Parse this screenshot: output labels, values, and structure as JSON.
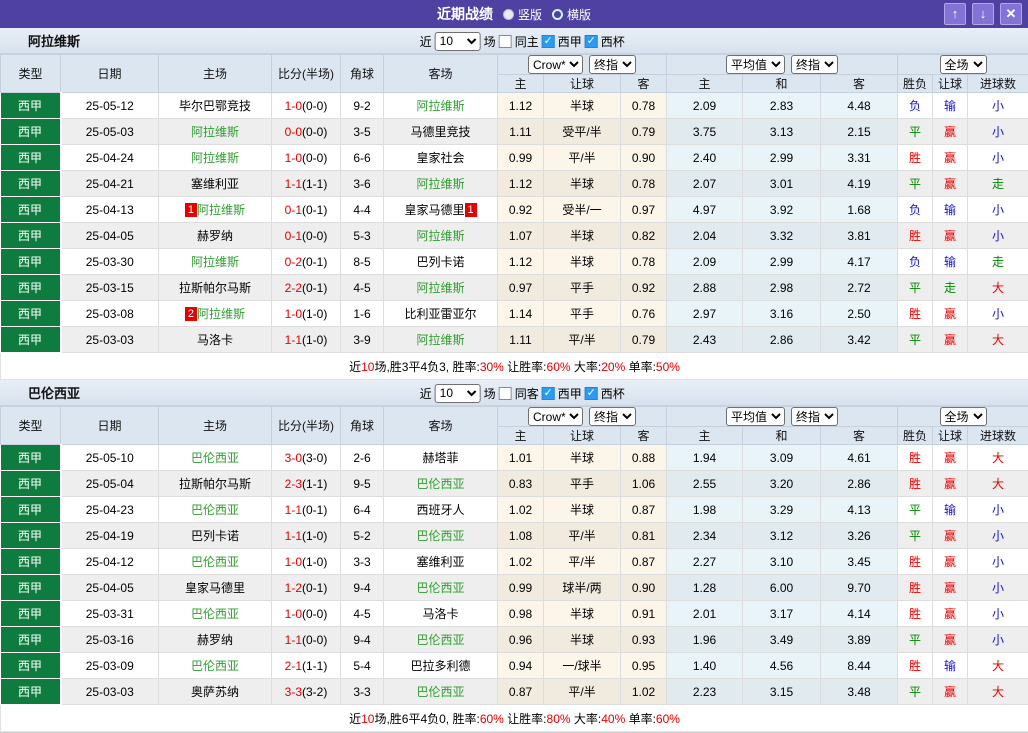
{
  "header": {
    "title": "近期战绩",
    "radio_vertical": "竖版",
    "radio_horizontal": "横版",
    "up_icon": "↑",
    "down_icon": "↓",
    "close_icon": "✕"
  },
  "colors": {
    "titlebar_purple": "#4e41a2",
    "type_green": "#0e7c3e",
    "focus_team_green": "#2f9e2f",
    "score_red": "#e60000",
    "win_red": "#e60000",
    "draw_green": "#008800",
    "lose_blue": "#1414cc",
    "checkbox_blue": "#2b9af3"
  },
  "columns": {
    "left": [
      "类型",
      "日期",
      "主场",
      "比分(半场)",
      "角球",
      "客场"
    ],
    "odds_group": [
      "主",
      "让球",
      "客"
    ],
    "avg_group": [
      "主",
      "和",
      "客"
    ],
    "result_group": [
      "胜负",
      "让球",
      "进球数"
    ]
  },
  "sections": [
    {
      "team": "阿拉维斯",
      "filter": {
        "near_label": "近",
        "count": "10",
        "unit_label": "场",
        "same_label": "同主",
        "same_checked": false,
        "league_label": "西甲",
        "league_checked": true,
        "cup_label": "西杯",
        "cup_checked": true
      },
      "dropdowns": {
        "odds_source": "Crow*",
        "odds_time": "终指",
        "average": "平均值",
        "average_time": "终指",
        "scope": "全场"
      },
      "rows": [
        {
          "type": "西甲",
          "date": "25-05-12",
          "home": "毕尔巴鄂竞技",
          "home_focus": false,
          "home_badge": "",
          "score": "1-0",
          "half": "(0-0)",
          "corner": "9-2",
          "away": "阿拉维斯",
          "away_focus": true,
          "away_badge": "",
          "crow_home": "1.12",
          "handicap": "半球",
          "crow_away": "0.78",
          "avg_home": "2.09",
          "avg_draw": "2.83",
          "avg_away": "4.48",
          "result": "负",
          "handicap_result": "输",
          "goals": "小"
        },
        {
          "type": "西甲",
          "date": "25-05-03",
          "home": "阿拉维斯",
          "home_focus": true,
          "home_badge": "",
          "score": "0-0",
          "half": "(0-0)",
          "corner": "3-5",
          "away": "马德里竞技",
          "away_focus": false,
          "away_badge": "",
          "crow_home": "1.11",
          "handicap": "受平/半",
          "crow_away": "0.79",
          "avg_home": "3.75",
          "avg_draw": "3.13",
          "avg_away": "2.15",
          "result": "平",
          "handicap_result": "赢",
          "goals": "小"
        },
        {
          "type": "西甲",
          "date": "25-04-24",
          "home": "阿拉维斯",
          "home_focus": true,
          "home_badge": "",
          "score": "1-0",
          "half": "(0-0)",
          "corner": "6-6",
          "away": "皇家社会",
          "away_focus": false,
          "away_badge": "",
          "crow_home": "0.99",
          "handicap": "平/半",
          "crow_away": "0.90",
          "avg_home": "2.40",
          "avg_draw": "2.99",
          "avg_away": "3.31",
          "result": "胜",
          "handicap_result": "赢",
          "goals": "小"
        },
        {
          "type": "西甲",
          "date": "25-04-21",
          "home": "塞维利亚",
          "home_focus": false,
          "home_badge": "",
          "score": "1-1",
          "half": "(1-1)",
          "corner": "3-6",
          "away": "阿拉维斯",
          "away_focus": true,
          "away_badge": "",
          "crow_home": "1.12",
          "handicap": "半球",
          "crow_away": "0.78",
          "avg_home": "2.07",
          "avg_draw": "3.01",
          "avg_away": "4.19",
          "result": "平",
          "handicap_result": "赢",
          "goals": "走"
        },
        {
          "type": "西甲",
          "date": "25-04-13",
          "home": "阿拉维斯",
          "home_focus": true,
          "home_badge": "1",
          "score": "0-1",
          "half": "(0-1)",
          "corner": "4-4",
          "away": "皇家马德里",
          "away_focus": false,
          "away_badge": "1",
          "crow_home": "0.92",
          "handicap": "受半/一",
          "crow_away": "0.97",
          "avg_home": "4.97",
          "avg_draw": "3.92",
          "avg_away": "1.68",
          "result": "负",
          "handicap_result": "输",
          "goals": "小"
        },
        {
          "type": "西甲",
          "date": "25-04-05",
          "home": "赫罗纳",
          "home_focus": false,
          "home_badge": "",
          "score": "0-1",
          "half": "(0-0)",
          "corner": "5-3",
          "away": "阿拉维斯",
          "away_focus": true,
          "away_badge": "",
          "crow_home": "1.07",
          "handicap": "半球",
          "crow_away": "0.82",
          "avg_home": "2.04",
          "avg_draw": "3.32",
          "avg_away": "3.81",
          "result": "胜",
          "handicap_result": "赢",
          "goals": "小"
        },
        {
          "type": "西甲",
          "date": "25-03-30",
          "home": "阿拉维斯",
          "home_focus": true,
          "home_badge": "",
          "score": "0-2",
          "half": "(0-1)",
          "corner": "8-5",
          "away": "巴列卡诺",
          "away_focus": false,
          "away_badge": "",
          "crow_home": "1.12",
          "handicap": "半球",
          "crow_away": "0.78",
          "avg_home": "2.09",
          "avg_draw": "2.99",
          "avg_away": "4.17",
          "result": "负",
          "handicap_result": "输",
          "goals": "走"
        },
        {
          "type": "西甲",
          "date": "25-03-15",
          "home": "拉斯帕尔马斯",
          "home_focus": false,
          "home_badge": "",
          "score": "2-2",
          "half": "(0-1)",
          "corner": "4-5",
          "away": "阿拉维斯",
          "away_focus": true,
          "away_badge": "",
          "crow_home": "0.97",
          "handicap": "平手",
          "crow_away": "0.92",
          "avg_home": "2.88",
          "avg_draw": "2.98",
          "avg_away": "2.72",
          "result": "平",
          "handicap_result": "走",
          "goals": "大"
        },
        {
          "type": "西甲",
          "date": "25-03-08",
          "home": "阿拉维斯",
          "home_focus": true,
          "home_badge": "2",
          "score": "1-0",
          "half": "(1-0)",
          "corner": "1-6",
          "away": "比利亚雷亚尔",
          "away_focus": false,
          "away_badge": "",
          "crow_home": "1.14",
          "handicap": "平手",
          "crow_away": "0.76",
          "avg_home": "2.97",
          "avg_draw": "3.16",
          "avg_away": "2.50",
          "result": "胜",
          "handicap_result": "赢",
          "goals": "小"
        },
        {
          "type": "西甲",
          "date": "25-03-03",
          "home": "马洛卡",
          "home_focus": false,
          "home_badge": "",
          "score": "1-1",
          "half": "(1-0)",
          "corner": "3-9",
          "away": "阿拉维斯",
          "away_focus": true,
          "away_badge": "",
          "crow_home": "1.11",
          "handicap": "平/半",
          "crow_away": "0.79",
          "avg_home": "2.43",
          "avg_draw": "2.86",
          "avg_away": "3.42",
          "result": "平",
          "handicap_result": "赢",
          "goals": "大"
        }
      ],
      "summary": [
        {
          "text": "近"
        },
        {
          "text": "10",
          "red": true
        },
        {
          "text": "场,胜3平4负3, 胜率:"
        },
        {
          "text": "30%",
          "red": true
        },
        {
          "text": " 让胜率:"
        },
        {
          "text": "60%",
          "red": true
        },
        {
          "text": " 大率:"
        },
        {
          "text": "20%",
          "red": true
        },
        {
          "text": " 单率:"
        },
        {
          "text": "50%",
          "red": true
        }
      ]
    },
    {
      "team": "巴伦西亚",
      "filter": {
        "near_label": "近",
        "count": "10",
        "unit_label": "场",
        "same_label": "同客",
        "same_checked": false,
        "league_label": "西甲",
        "league_checked": true,
        "cup_label": "西杯",
        "cup_checked": true
      },
      "dropdowns": {
        "odds_source": "Crow*",
        "odds_time": "终指",
        "average": "平均值",
        "average_time": "终指",
        "scope": "全场"
      },
      "rows": [
        {
          "type": "西甲",
          "date": "25-05-10",
          "home": "巴伦西亚",
          "home_focus": true,
          "home_badge": "",
          "score": "3-0",
          "half": "(3-0)",
          "corner": "2-6",
          "away": "赫塔菲",
          "away_focus": false,
          "away_badge": "",
          "crow_home": "1.01",
          "handicap": "半球",
          "crow_away": "0.88",
          "avg_home": "1.94",
          "avg_draw": "3.09",
          "avg_away": "4.61",
          "result": "胜",
          "handicap_result": "赢",
          "goals": "大"
        },
        {
          "type": "西甲",
          "date": "25-05-04",
          "home": "拉斯帕尔马斯",
          "home_focus": false,
          "home_badge": "",
          "score": "2-3",
          "half": "(1-1)",
          "corner": "9-5",
          "away": "巴伦西亚",
          "away_focus": true,
          "away_badge": "",
          "crow_home": "0.83",
          "handicap": "平手",
          "crow_away": "1.06",
          "avg_home": "2.55",
          "avg_draw": "3.20",
          "avg_away": "2.86",
          "result": "胜",
          "handicap_result": "赢",
          "goals": "大"
        },
        {
          "type": "西甲",
          "date": "25-04-23",
          "home": "巴伦西亚",
          "home_focus": true,
          "home_badge": "",
          "score": "1-1",
          "half": "(0-1)",
          "corner": "6-4",
          "away": "西班牙人",
          "away_focus": false,
          "away_badge": "",
          "crow_home": "1.02",
          "handicap": "半球",
          "crow_away": "0.87",
          "avg_home": "1.98",
          "avg_draw": "3.29",
          "avg_away": "4.13",
          "result": "平",
          "handicap_result": "输",
          "goals": "小"
        },
        {
          "type": "西甲",
          "date": "25-04-19",
          "home": "巴列卡诺",
          "home_focus": false,
          "home_badge": "",
          "score": "1-1",
          "half": "(1-0)",
          "corner": "5-2",
          "away": "巴伦西亚",
          "away_focus": true,
          "away_badge": "",
          "crow_home": "1.08",
          "handicap": "平/半",
          "crow_away": "0.81",
          "avg_home": "2.34",
          "avg_draw": "3.12",
          "avg_away": "3.26",
          "result": "平",
          "handicap_result": "赢",
          "goals": "小"
        },
        {
          "type": "西甲",
          "date": "25-04-12",
          "home": "巴伦西亚",
          "home_focus": true,
          "home_badge": "",
          "score": "1-0",
          "half": "(1-0)",
          "corner": "3-3",
          "away": "塞维利亚",
          "away_focus": false,
          "away_badge": "",
          "crow_home": "1.02",
          "handicap": "平/半",
          "crow_away": "0.87",
          "avg_home": "2.27",
          "avg_draw": "3.10",
          "avg_away": "3.45",
          "result": "胜",
          "handicap_result": "赢",
          "goals": "小"
        },
        {
          "type": "西甲",
          "date": "25-04-05",
          "home": "皇家马德里",
          "home_focus": false,
          "home_badge": "",
          "score": "1-2",
          "half": "(0-1)",
          "corner": "9-4",
          "away": "巴伦西亚",
          "away_focus": true,
          "away_badge": "",
          "crow_home": "0.99",
          "handicap": "球半/两",
          "crow_away": "0.90",
          "avg_home": "1.28",
          "avg_draw": "6.00",
          "avg_away": "9.70",
          "result": "胜",
          "handicap_result": "赢",
          "goals": "小"
        },
        {
          "type": "西甲",
          "date": "25-03-31",
          "home": "巴伦西亚",
          "home_focus": true,
          "home_badge": "",
          "score": "1-0",
          "half": "(0-0)",
          "corner": "4-5",
          "away": "马洛卡",
          "away_focus": false,
          "away_badge": "",
          "crow_home": "0.98",
          "handicap": "半球",
          "crow_away": "0.91",
          "avg_home": "2.01",
          "avg_draw": "3.17",
          "avg_away": "4.14",
          "result": "胜",
          "handicap_result": "赢",
          "goals": "小"
        },
        {
          "type": "西甲",
          "date": "25-03-16",
          "home": "赫罗纳",
          "home_focus": false,
          "home_badge": "",
          "score": "1-1",
          "half": "(0-0)",
          "corner": "9-4",
          "away": "巴伦西亚",
          "away_focus": true,
          "away_badge": "",
          "crow_home": "0.96",
          "handicap": "半球",
          "crow_away": "0.93",
          "avg_home": "1.96",
          "avg_draw": "3.49",
          "avg_away": "3.89",
          "result": "平",
          "handicap_result": "赢",
          "goals": "小"
        },
        {
          "type": "西甲",
          "date": "25-03-09",
          "home": "巴伦西亚",
          "home_focus": true,
          "home_badge": "",
          "score": "2-1",
          "half": "(1-1)",
          "corner": "5-4",
          "away": "巴拉多利德",
          "away_focus": false,
          "away_badge": "",
          "crow_home": "0.94",
          "handicap": "一/球半",
          "crow_away": "0.95",
          "avg_home": "1.40",
          "avg_draw": "4.56",
          "avg_away": "8.44",
          "result": "胜",
          "handicap_result": "输",
          "goals": "大"
        },
        {
          "type": "西甲",
          "date": "25-03-03",
          "home": "奥萨苏纳",
          "home_focus": false,
          "home_badge": "",
          "score": "3-3",
          "half": "(3-2)",
          "corner": "3-3",
          "away": "巴伦西亚",
          "away_focus": true,
          "away_badge": "",
          "crow_home": "0.87",
          "handicap": "平/半",
          "crow_away": "1.02",
          "avg_home": "2.23",
          "avg_draw": "3.15",
          "avg_away": "3.48",
          "result": "平",
          "handicap_result": "赢",
          "goals": "大"
        }
      ],
      "summary": [
        {
          "text": "近"
        },
        {
          "text": "10",
          "red": true
        },
        {
          "text": "场,胜6平4负0, 胜率:"
        },
        {
          "text": "60%",
          "red": true
        },
        {
          "text": " 让胜率:"
        },
        {
          "text": "80%",
          "red": true
        },
        {
          "text": " 大率:"
        },
        {
          "text": "40%",
          "red": true
        },
        {
          "text": " 单率:"
        },
        {
          "text": "60%",
          "red": true
        }
      ]
    }
  ]
}
